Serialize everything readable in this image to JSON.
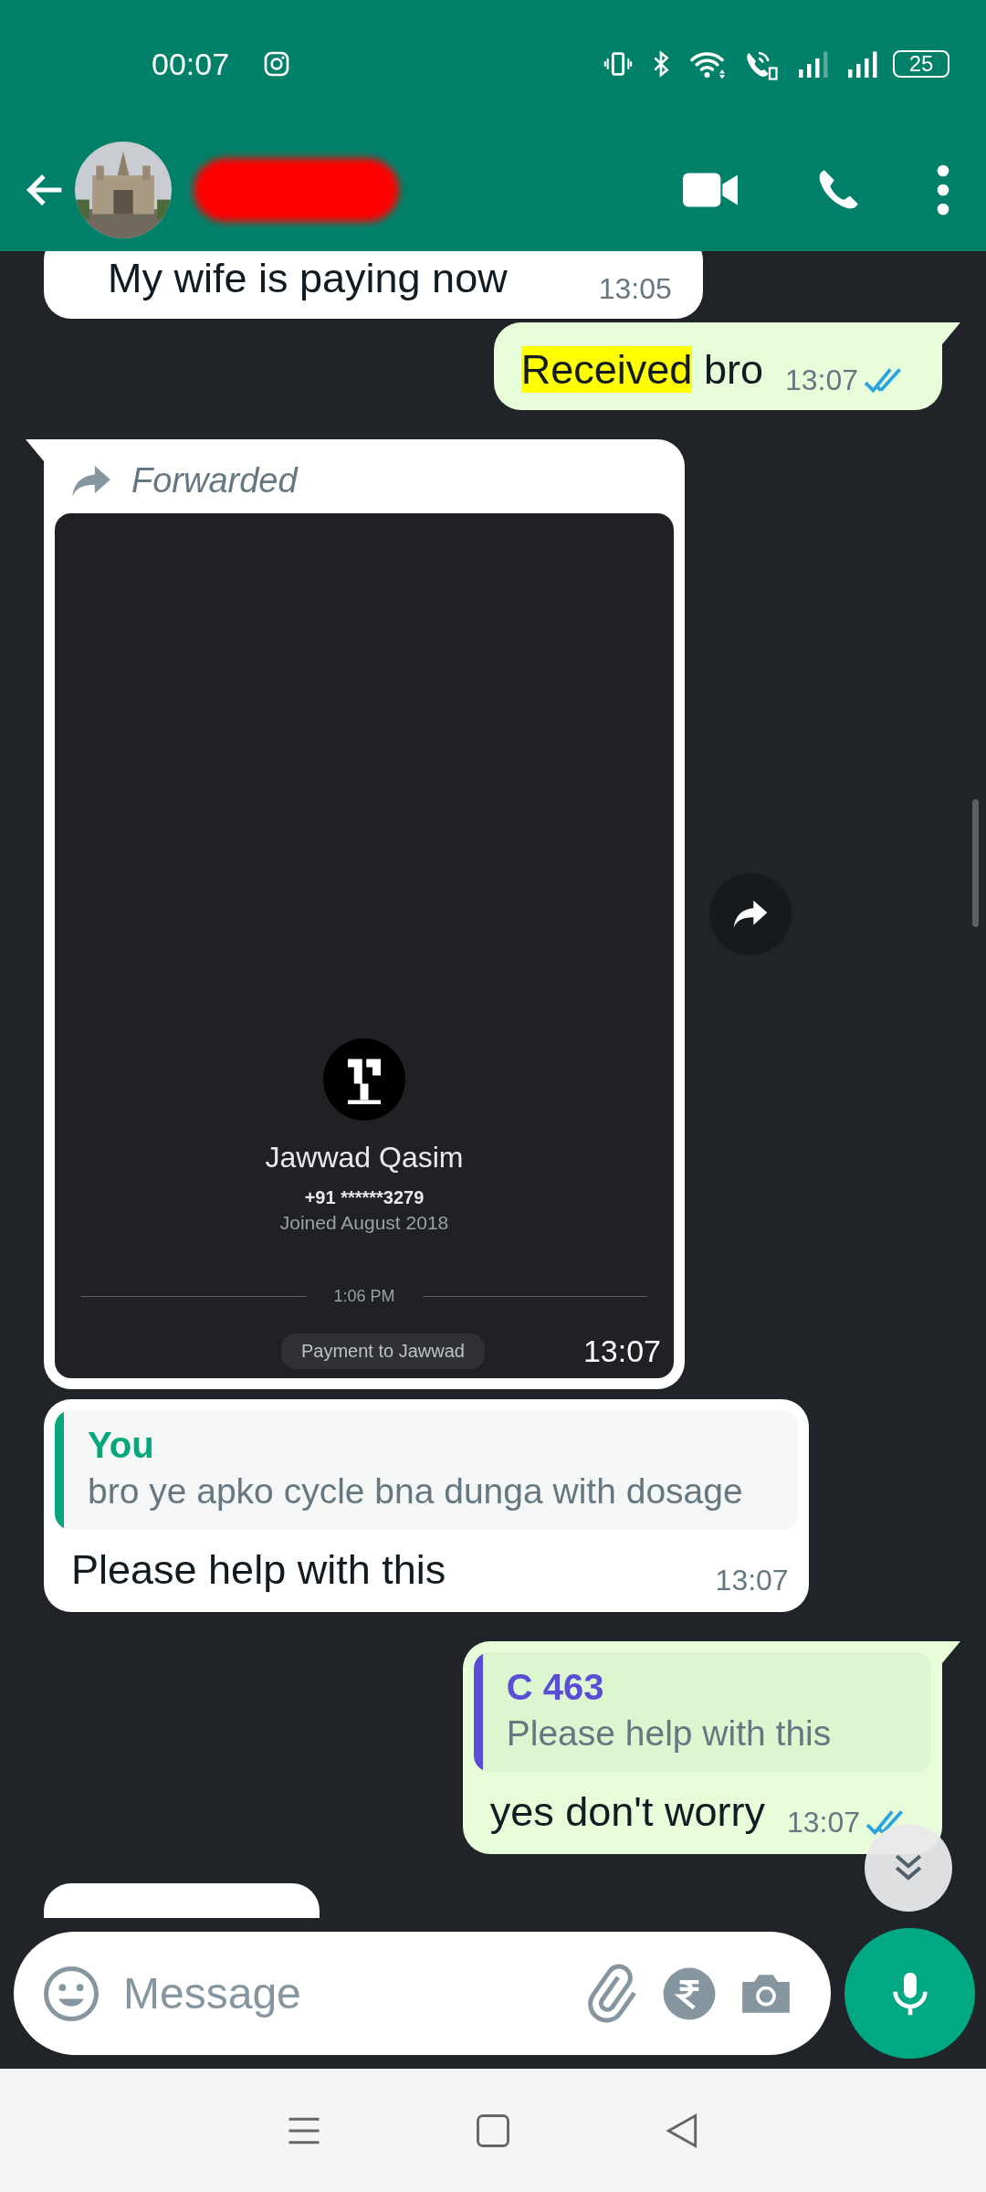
{
  "status_bar": {
    "time": "00:07",
    "battery": "25"
  },
  "messages": [
    {
      "kind": "text",
      "outgoing": false,
      "tail": false,
      "parts": [
        {
          "text": "My wife is paying now",
          "highlighted": false
        }
      ],
      "time": "13:05"
    },
    {
      "kind": "text",
      "outgoing": true,
      "tail": true,
      "parts": [
        {
          "text": "Received",
          "highlighted": true
        },
        {
          "text": " bro",
          "highlighted": false
        }
      ],
      "time": "13:07",
      "read": true
    },
    {
      "outgoing": false,
      "tail": true,
      "forwarded": true,
      "forwarded_label": "Forwarded",
      "time": "13:07",
      "screenshot": {
        "name": "Jawwad Qasim",
        "phone": "+91 ******3279",
        "joined": "Joined August 2018",
        "divider_time": "1:06 PM",
        "payment": "Payment to Jawwad"
      }
    },
    {
      "kind": "reply",
      "outgoing": false,
      "tail": false,
      "quote": {
        "author": "You",
        "color": "#06a77d",
        "text": "bro ye apko cycle bna dunga with dosage"
      },
      "text": "Please help with this",
      "time": "13:07"
    },
    {
      "kind": "reply",
      "outgoing": true,
      "tail": true,
      "quote": {
        "author": "C 463",
        "color": "#5b4cd6",
        "text": "Please help with this"
      },
      "text": "yes don't worry",
      "time": "13:07",
      "read": true
    },
    {
      "kind": "peek",
      "outgoing": false
    }
  ],
  "composer": {
    "placeholder": "Message"
  }
}
